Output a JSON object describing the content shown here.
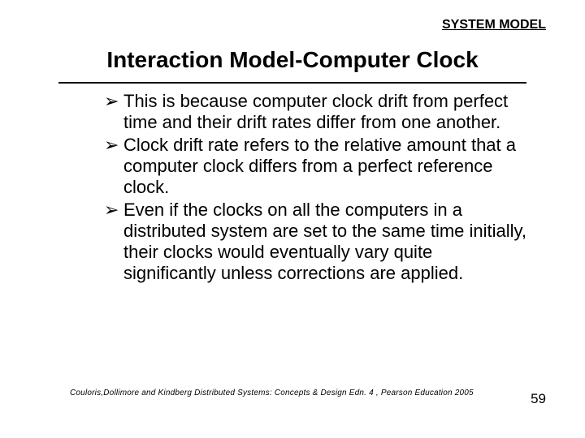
{
  "header": {
    "label": "SYSTEM MODEL"
  },
  "title": "Interaction Model-Computer Clock",
  "bullets": [
    "This is because computer clock drift from perfect time and their drift rates differ from one another.",
    "Clock drift rate refers to the relative amount that a computer clock differs from a perfect reference clock.",
    "Even if the clocks on all the computers in a distributed system are set to the same time initially, their clocks would eventually vary quite significantly unless corrections are applied."
  ],
  "footer": {
    "citation": "Couloris,Dollimore and Kindberg  Distributed Systems: Concepts & Design  Edn. 4 , Pearson Education 2005",
    "page": "59"
  },
  "marker": "➢"
}
